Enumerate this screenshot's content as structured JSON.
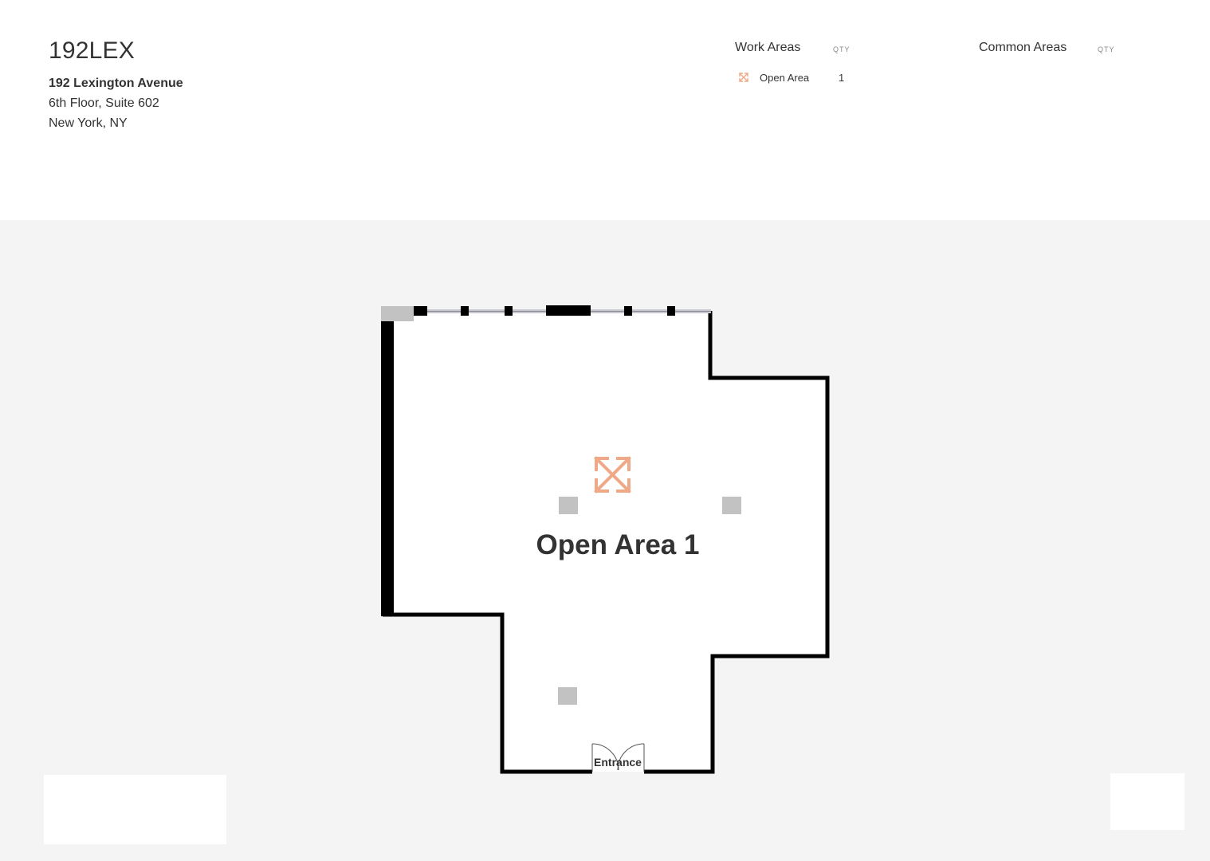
{
  "header": {
    "building_name": "192LEX",
    "address_line1": "192 Lexington Avenue",
    "address_line2": "6th Floor, Suite 602",
    "address_line3": "New York, NY"
  },
  "legend": {
    "work_areas": {
      "title": "Work Areas",
      "qty_label": "QTY",
      "items": [
        {
          "label": "Open Area",
          "qty": "1",
          "icon": "expand-arrows-icon",
          "color": "#f0a987"
        }
      ]
    },
    "common_areas": {
      "title": "Common Areas",
      "qty_label": "QTY"
    }
  },
  "floorplan": {
    "room_label": "Open Area 1",
    "room_icon": "expand-arrows-icon",
    "entrance_label": "Entrance",
    "colors": {
      "wall": "#000000",
      "room_fill": "#ffffff",
      "background": "#f4f4f4",
      "column": "#c2c2c2",
      "accent": "#f0a987",
      "window": "#c8c8d0"
    }
  }
}
